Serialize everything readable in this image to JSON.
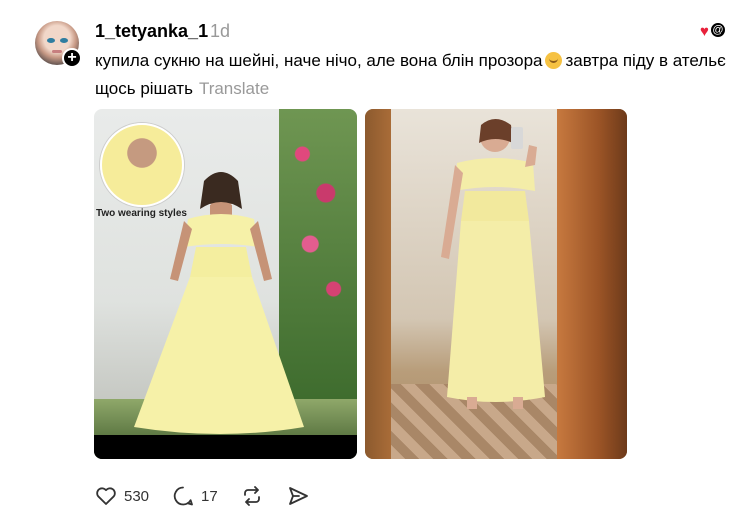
{
  "post": {
    "username": "1_tetyanka_1",
    "time": "1d",
    "text_before_emoji": "купила сукню на шейні, наче нічо, але вона блін прозора",
    "text_after_emoji": "завтра піду в ательє щось рішать",
    "translate_label": "Translate",
    "emoji": "face-with-hand-over-mouth-emoji"
  },
  "images": {
    "product_photo": {
      "inset_label": "Two wearing styles",
      "dress_color": "#f6f1a8"
    },
    "mirror_selfie": {
      "dress_color": "#f4eda8"
    }
  },
  "actions": {
    "likes": "530",
    "replies": "17",
    "repost_icon": "repost-icon",
    "share_icon": "share-icon"
  },
  "colors": {
    "heart": "#e8213b",
    "muted_text": "#999999"
  }
}
